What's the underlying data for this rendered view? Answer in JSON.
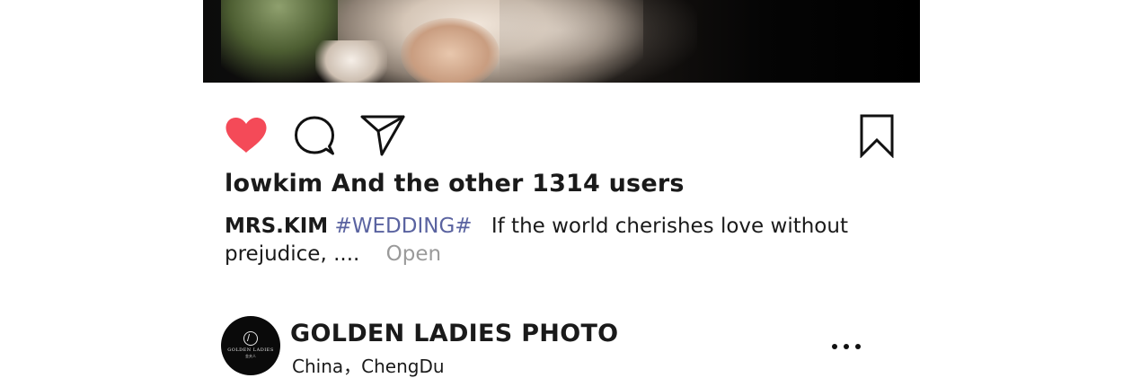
{
  "post": {
    "likes_text": "lowkim And the other 1314 users",
    "caption": {
      "author": "MRS.KIM",
      "hashtag": "#WEDDING#",
      "text_line1": "If the world cherishes love without",
      "text_line2": "prejudice, ....",
      "open_label": "Open"
    },
    "liked": true
  },
  "next_post": {
    "account_name": "GOLDEN LADIES PHOTO",
    "location": "China，ChengDu",
    "avatar_logo_text": "GOLDEN LADIES",
    "avatar_logo_sub": "金夫人"
  },
  "icons": {
    "like": "heart-icon",
    "comment": "comment-icon",
    "share": "send-icon",
    "save": "bookmark-icon",
    "more": "more-dots-icon"
  },
  "colors": {
    "heart": "#f44a58",
    "hashtag": "#5a63a0",
    "muted": "#9a9a9a",
    "text": "#1a1a1a"
  }
}
